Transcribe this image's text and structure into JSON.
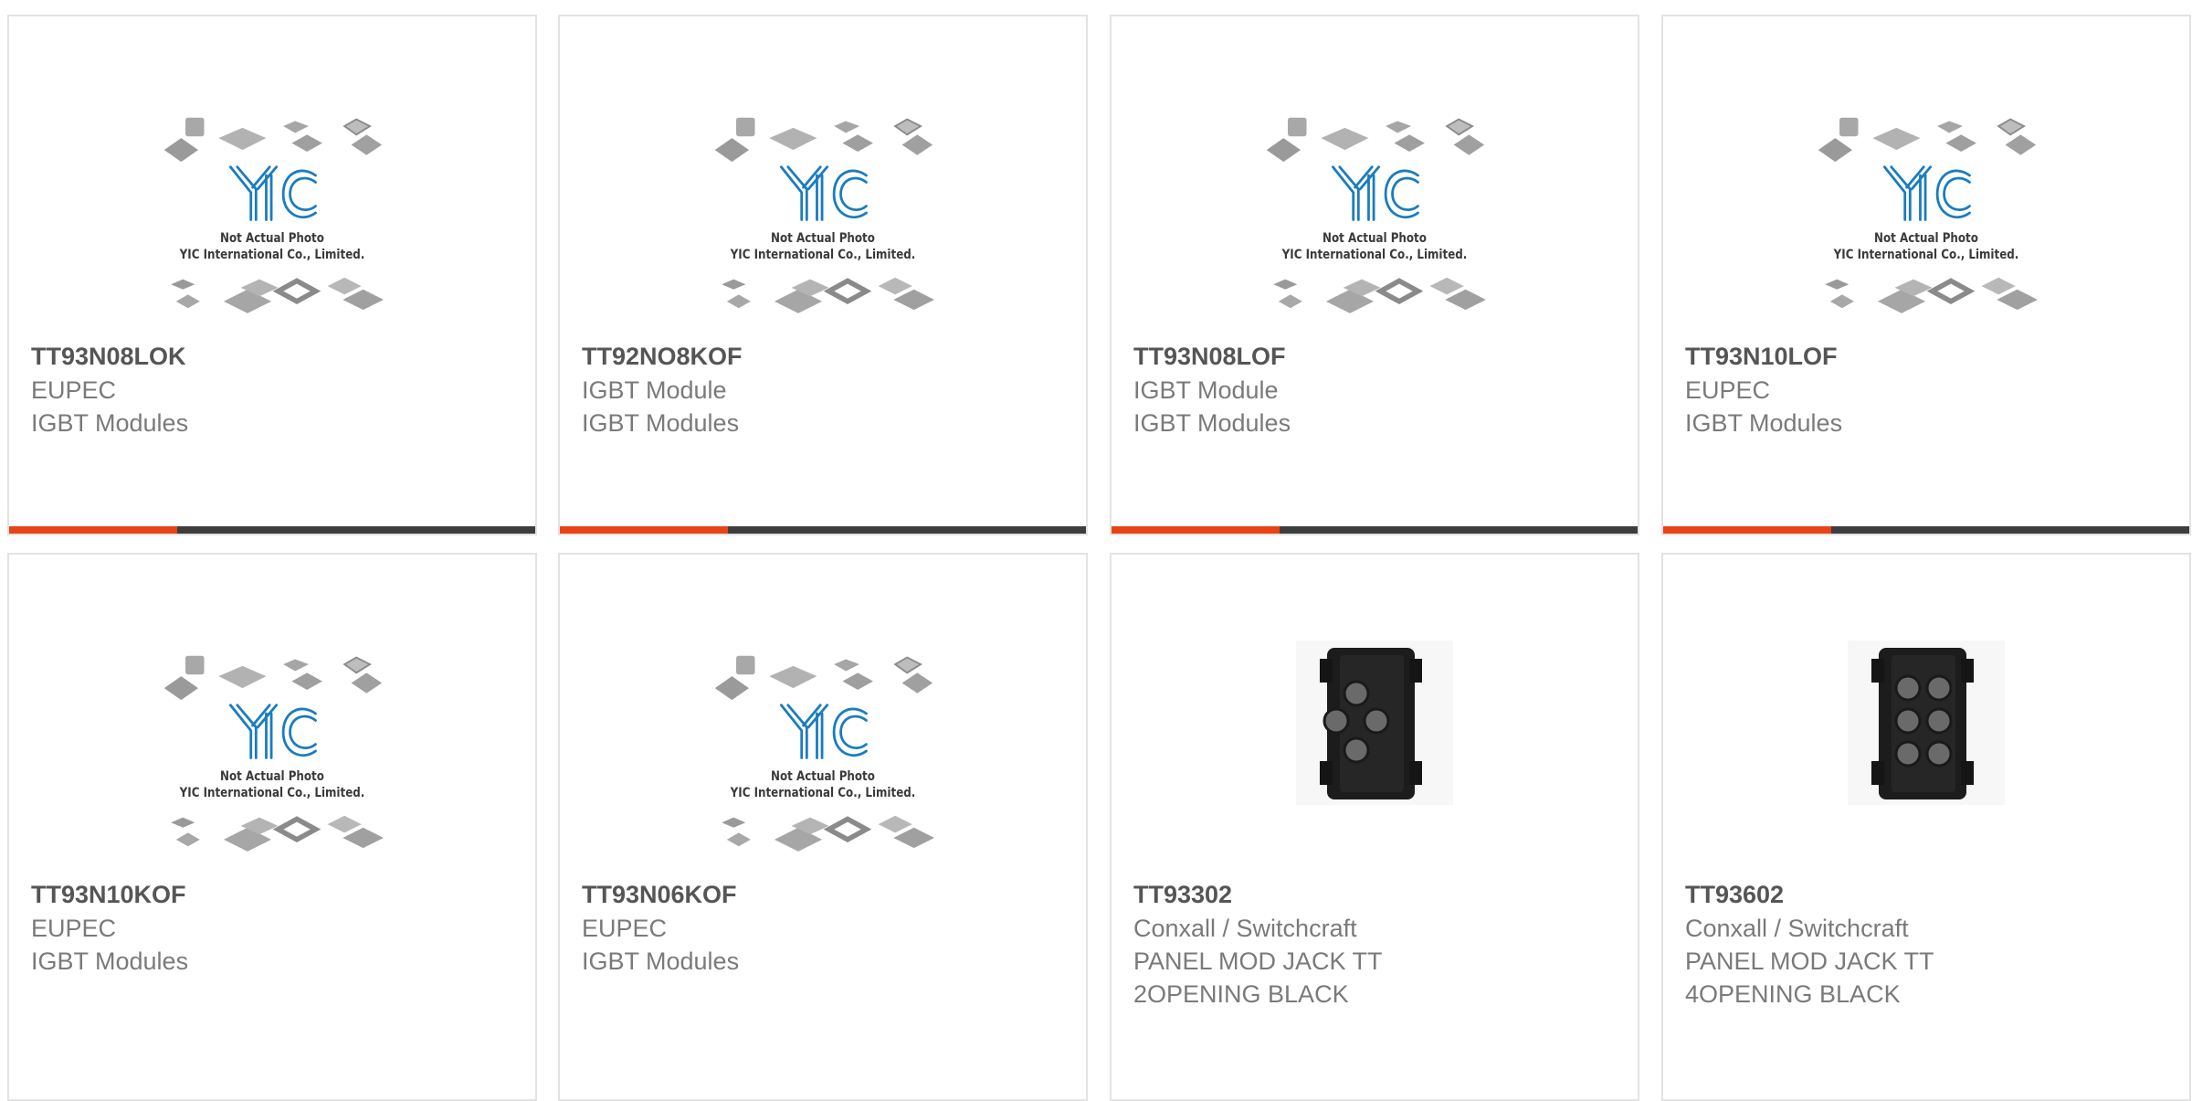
{
  "colors": {
    "accent": "#e84316",
    "bar": "#3d3d3d",
    "border": "#e3e3e3",
    "logo_blue": "#1a7cc0"
  },
  "placeholder": {
    "line1": "Not Actual Photo",
    "line2": "YIC International Co., Limited.",
    "logo_text": "YIC"
  },
  "products": [
    {
      "part_no": "TT93N08LOK",
      "lines": [
        "EUPEC",
        "IGBT Modules"
      ],
      "image": "placeholder",
      "accent_bar": true
    },
    {
      "part_no": "TT92NO8KOF",
      "lines": [
        "IGBT Module",
        "IGBT Modules"
      ],
      "image": "placeholder",
      "accent_bar": true
    },
    {
      "part_no": "TT93N08LOF",
      "lines": [
        "IGBT Module",
        "IGBT Modules"
      ],
      "image": "placeholder",
      "accent_bar": true
    },
    {
      "part_no": "TT93N10LOF",
      "lines": [
        "EUPEC",
        "IGBT Modules"
      ],
      "image": "placeholder",
      "accent_bar": true
    },
    {
      "part_no": "TT93N10KOF",
      "lines": [
        "EUPEC",
        "IGBT Modules"
      ],
      "image": "placeholder",
      "accent_bar": false
    },
    {
      "part_no": "TT93N06KOF",
      "lines": [
        "EUPEC",
        "IGBT Modules"
      ],
      "image": "placeholder",
      "accent_bar": false
    },
    {
      "part_no": "TT93302",
      "lines": [
        "Conxall / Switchcraft",
        "PANEL MOD JACK TT",
        "2OPENING BLACK"
      ],
      "image": "jack-panel-2-opening",
      "accent_bar": false
    },
    {
      "part_no": "TT93602",
      "lines": [
        "Conxall / Switchcraft",
        "PANEL MOD JACK TT",
        "4OPENING BLACK"
      ],
      "image": "jack-panel-4-opening",
      "accent_bar": false
    }
  ]
}
